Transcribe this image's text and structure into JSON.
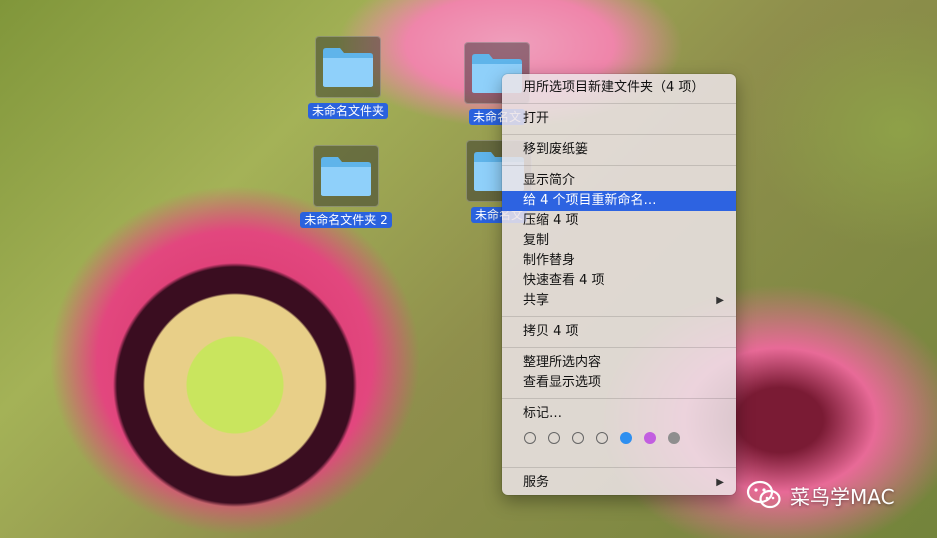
{
  "desktop": {
    "icons": [
      {
        "label": "未命名文件夹"
      },
      {
        "label": "未命名文"
      },
      {
        "label": "未命名文件夹 2"
      },
      {
        "label": "未命名文"
      }
    ]
  },
  "menu": {
    "new_folder_with_selection": "用所选项目新建文件夹（4 项）",
    "open": "打开",
    "move_to_trash": "移到废纸篓",
    "get_info": "显示简介",
    "rename_items": "给 4 个项目重新命名…",
    "compress": "压缩 4 项",
    "duplicate": "复制",
    "make_alias": "制作替身",
    "quick_look": "快速查看 4 项",
    "share": "共享",
    "copy_items": "拷贝 4 项",
    "clean_up_selection": "整理所选内容",
    "show_view_options": "查看显示选项",
    "tags": "标记…",
    "services": "服务",
    "highlighted_item": "rename_items",
    "tag_colors": [
      "empty",
      "empty",
      "empty",
      "empty",
      "#2e8ff0",
      "#c25ee0",
      "#8e8e8e"
    ]
  },
  "watermark": {
    "text": "菜鸟学MAC",
    "icon": "wechat-icon"
  }
}
